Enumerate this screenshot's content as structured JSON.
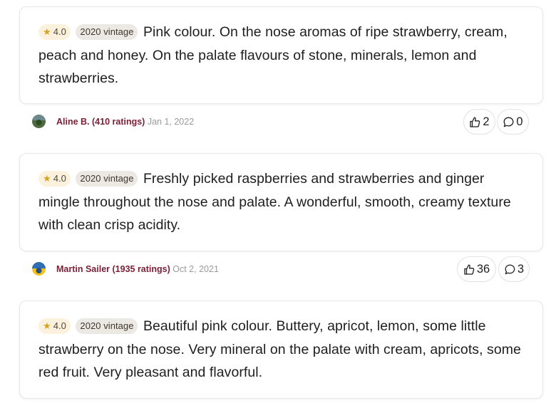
{
  "reviews": [
    {
      "rating": "4.0",
      "vintage": "2020 vintage",
      "text": "Pink colour. On the nose aromas of ripe strawberry, cream, peach and honey. On the palate flavours of stone, minerals, lemon and strawberries.",
      "author": "Aline B. (410 ratings)",
      "date": "Jan 1, 2022",
      "likes": "2",
      "comments": "0"
    },
    {
      "rating": "4.0",
      "vintage": "2020 vintage",
      "text": "Freshly picked raspberries and strawberries and ginger mingle throughout the nose and palate. A wonderful, smooth, creamy texture with clean crisp acidity.",
      "author": "Martin Sailer (1935 ratings)",
      "date": "Oct 2, 2021",
      "likes": "36",
      "comments": "3"
    },
    {
      "rating": "4.0",
      "vintage": "2020 vintage",
      "text": "Beautiful pink colour. Buttery, apricot, lemon, some little strawberry on the nose. Very mineral on the palate with cream, apricots, some red fruit. Very pleasant and flavorful."
    }
  ],
  "icons": {
    "star": "star-icon",
    "like": "thumbs-up-icon",
    "comment": "comment-icon"
  },
  "colors": {
    "author": "#7b1e35",
    "star": "#d9a21b",
    "rating_bg": "#fbf1dd",
    "vintage_bg": "#ece8e4"
  }
}
